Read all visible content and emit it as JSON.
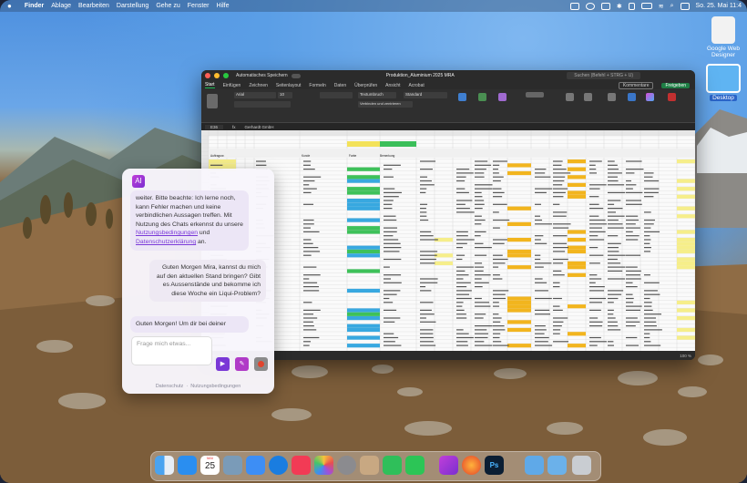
{
  "menubar": {
    "apple": "",
    "items": [
      "Finder",
      "Ablage",
      "Bearbeiten",
      "Darstellung",
      "Gehe zu",
      "Fenster",
      "Hilfe"
    ],
    "clock": "So. 25. Mai  11:4"
  },
  "desktop": {
    "icons": [
      {
        "label": "Google Web Designer"
      },
      {
        "label": "Desktop"
      }
    ]
  },
  "excel": {
    "autosave": "Automatisches Speichern",
    "title": "Produktion_Aluminium 2025 MRA",
    "search_placeholder": "Suchen (Befehl + STRG + U)",
    "tabs": [
      "Start",
      "Einfügen",
      "Zeichnen",
      "Seitenlayout",
      "Formeln",
      "Daten",
      "Überprüfen",
      "Ansicht",
      "Acrobat"
    ],
    "active_tab": "Start",
    "font_name": "Arial",
    "font_size": "10",
    "wrap": "Textumbruch",
    "merge": "Verbinden und zentrieren",
    "number_format": "Standard",
    "comments_btn": "Kommentare",
    "share_btn": "Freigeben",
    "cell_ref": "E36",
    "formula_value": "Gerhardt GmbH",
    "header_row": [
      "Auftragsnr.",
      "",
      "",
      "",
      "Kunde",
      "Rechnung",
      "Kunde/Ort",
      "Farbe",
      "Bemerkung",
      "Material",
      "Fertigmeldung",
      "Fertigdatum",
      "Lieferung"
    ],
    "status_left": "Bereit",
    "zoom": "100 %"
  },
  "chat": {
    "logo": "AI",
    "ai_msg_1_a": "weiter. Bitte beachte: Ich lerne noch, kann Fehler machen und keine verbindlichen Aussagen treffen. Mit Nutzung des Chats erkennst du unsere",
    "ai_msg_1_link1": "Nutzungsbedingungen",
    "ai_msg_1_and": " und",
    "ai_msg_1_link2": "Datenschutzerklärung",
    "ai_msg_1_end": " an.",
    "user_msg": "Guten Morgen Mira, kannst du mich auf den aktuellen Stand bringen? Gibt es Aussenstände und bekomme ich diese Woche ein Liqui-Problem?",
    "ai_msg_2": "Guten Morgen! Um dir bei deiner",
    "input_placeholder": "Frage mich etwas...",
    "footer_privacy": "Datenschutz",
    "footer_terms": "Nutzungsbedingungen"
  },
  "dock": {
    "calendar_day": "25",
    "calendar_month": "MAI",
    "apps": [
      "finder",
      "app-store",
      "calendar",
      "preview",
      "mail",
      "safari",
      "music",
      "photos",
      "settings",
      "contacts",
      "numbers",
      "whatsapp",
      "mira",
      "firefox",
      "photoshop",
      "folder",
      "downloads",
      "trash"
    ]
  }
}
